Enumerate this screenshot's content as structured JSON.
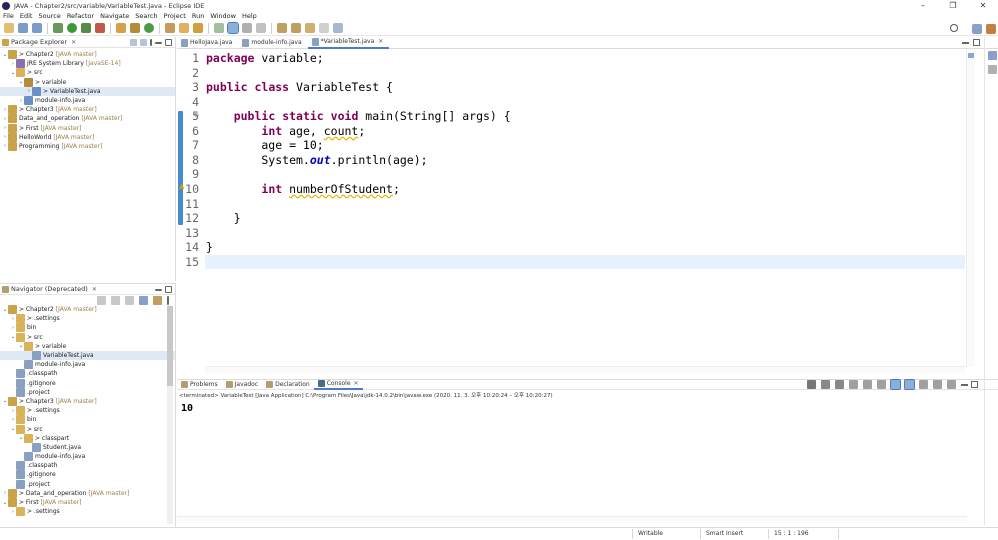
{
  "window": {
    "title": "JAVA - Chapter2/src/variable/VariableTest.java - Eclipse IDE",
    "minimize": "–",
    "maximize": "❐",
    "close": "✕"
  },
  "menu": [
    "File",
    "Edit",
    "Source",
    "Refactor",
    "Navigate",
    "Search",
    "Project",
    "Run",
    "Window",
    "Help"
  ],
  "package_explorer": {
    "title": "Package Explorer",
    "items": [
      {
        "indent": 0,
        "twisty": "v",
        "label": "> Chapter2",
        "deco": "[JAVA master]",
        "icon": "project-icon",
        "color": "#c9a24a"
      },
      {
        "indent": 1,
        "twisty": ">",
        "label": "JRE System Library",
        "deco": "[JavaSE-14]",
        "icon": "library-icon",
        "color": "#8a6fb0"
      },
      {
        "indent": 1,
        "twisty": "v",
        "label": "> src",
        "deco": "",
        "icon": "folder-icon",
        "color": "#d9b25a"
      },
      {
        "indent": 2,
        "twisty": "v",
        "label": "> variable",
        "deco": "",
        "icon": "package-icon",
        "color": "#b58a3a"
      },
      {
        "indent": 3,
        "twisty": ">",
        "label": "> VariableTest.java",
        "deco": "",
        "icon": "java-file-icon",
        "color": "#6a8fc4",
        "selected": true
      },
      {
        "indent": 2,
        "twisty": ">",
        "label": "module-info.java",
        "deco": "",
        "icon": "java-file-icon",
        "color": "#6a8fc4"
      },
      {
        "indent": 0,
        "twisty": ">",
        "label": "> Chapter3",
        "deco": "[JAVA master]",
        "icon": "project-icon",
        "color": "#c9a24a"
      },
      {
        "indent": 0,
        "twisty": ">",
        "label": "Data_and_operation",
        "deco": "[JAVA master]",
        "icon": "project-icon",
        "color": "#c9a24a"
      },
      {
        "indent": 0,
        "twisty": ">",
        "label": "> First",
        "deco": "[JAVA master]",
        "icon": "project-icon",
        "color": "#c9a24a"
      },
      {
        "indent": 0,
        "twisty": ">",
        "label": "HelloWorld",
        "deco": "[JAVA master]",
        "icon": "project-icon",
        "color": "#c9a24a"
      },
      {
        "indent": 0,
        "twisty": ">",
        "label": "Programming",
        "deco": "[JAVA master]",
        "icon": "project-icon",
        "color": "#c9a24a"
      }
    ]
  },
  "navigator": {
    "title": "Navigator (Deprecated)",
    "items": [
      {
        "indent": 0,
        "twisty": "v",
        "label": "> Chapter2",
        "deco": "[JAVA master]",
        "color": "#c9a24a"
      },
      {
        "indent": 1,
        "twisty": ">",
        "label": "> .settings",
        "deco": "",
        "color": "#d9b25a"
      },
      {
        "indent": 1,
        "twisty": ">",
        "label": "bin",
        "deco": "",
        "color": "#d9b25a"
      },
      {
        "indent": 1,
        "twisty": "v",
        "label": "> src",
        "deco": "",
        "color": "#d9b25a"
      },
      {
        "indent": 2,
        "twisty": "v",
        "label": "> variable",
        "deco": "",
        "color": "#d9b25a"
      },
      {
        "indent": 3,
        "twisty": "",
        "label": "VariableTest.java",
        "deco": "",
        "color": "#8aa0c0",
        "selected": true
      },
      {
        "indent": 2,
        "twisty": "",
        "label": "module-info.java",
        "deco": "",
        "color": "#8aa0c0"
      },
      {
        "indent": 1,
        "twisty": "",
        "label": ".classpath",
        "deco": "",
        "color": "#8aa0c0"
      },
      {
        "indent": 1,
        "twisty": "",
        "label": ".gitignore",
        "deco": "",
        "color": "#8aa0c0"
      },
      {
        "indent": 1,
        "twisty": "",
        "label": ".project",
        "deco": "",
        "color": "#8aa0c0"
      },
      {
        "indent": 0,
        "twisty": "v",
        "label": "> Chapter3",
        "deco": "[JAVA master]",
        "color": "#c9a24a"
      },
      {
        "indent": 1,
        "twisty": ">",
        "label": "> .settings",
        "deco": "",
        "color": "#d9b25a"
      },
      {
        "indent": 1,
        "twisty": ">",
        "label": "bin",
        "deco": "",
        "color": "#d9b25a"
      },
      {
        "indent": 1,
        "twisty": "v",
        "label": "> src",
        "deco": "",
        "color": "#d9b25a"
      },
      {
        "indent": 2,
        "twisty": "v",
        "label": "> classpart",
        "deco": "",
        "color": "#d9b25a"
      },
      {
        "indent": 3,
        "twisty": "",
        "label": "Student.java",
        "deco": "",
        "color": "#8aa0c0"
      },
      {
        "indent": 2,
        "twisty": "",
        "label": "module-info.java",
        "deco": "",
        "color": "#8aa0c0"
      },
      {
        "indent": 1,
        "twisty": "",
        "label": ".classpath",
        "deco": "",
        "color": "#8aa0c0"
      },
      {
        "indent": 1,
        "twisty": "",
        "label": ".gitignore",
        "deco": "",
        "color": "#8aa0c0"
      },
      {
        "indent": 1,
        "twisty": "",
        "label": ".project",
        "deco": "",
        "color": "#8aa0c0"
      },
      {
        "indent": 0,
        "twisty": ">",
        "label": "> Data_and_operation",
        "deco": "[JAVA master]",
        "color": "#c9a24a"
      },
      {
        "indent": 0,
        "twisty": "v",
        "label": "> First",
        "deco": "[JAVA master]",
        "color": "#c9a24a"
      },
      {
        "indent": 1,
        "twisty": ">",
        "label": "> .settings",
        "deco": "",
        "color": "#d9b25a"
      }
    ]
  },
  "editor": {
    "tabs": [
      {
        "label": "HelloJava.java",
        "active": false
      },
      {
        "label": "module-info.java",
        "active": false
      },
      {
        "label": "*VariableTest.java",
        "active": true
      }
    ],
    "line_numbers": [
      "1",
      "2",
      "3",
      "4",
      "5",
      "6",
      "7",
      "8",
      "9",
      "10",
      "11",
      "12",
      "13",
      "14",
      "15"
    ],
    "lines": [
      [
        {
          "t": "package",
          "c": "kw"
        },
        {
          "t": " variable;"
        }
      ],
      [],
      [
        {
          "t": "public",
          "c": "kw"
        },
        {
          "t": " "
        },
        {
          "t": "class",
          "c": "kw"
        },
        {
          "t": " VariableTest {"
        }
      ],
      [],
      [
        {
          "t": "    "
        },
        {
          "t": "public",
          "c": "kw"
        },
        {
          "t": " "
        },
        {
          "t": "static",
          "c": "kw"
        },
        {
          "t": " "
        },
        {
          "t": "void",
          "c": "kw"
        },
        {
          "t": " main(String[] args) {"
        }
      ],
      [
        {
          "t": "        "
        },
        {
          "t": "int",
          "c": "kw"
        },
        {
          "t": " age, "
        },
        {
          "t": "count",
          "c": "warn"
        },
        {
          "t": ";"
        }
      ],
      [
        {
          "t": "        age = 10;"
        }
      ],
      [
        {
          "t": "        System."
        },
        {
          "t": "out",
          "c": "static-f"
        },
        {
          "t": ".println(age);"
        }
      ],
      [],
      [
        {
          "t": "        "
        },
        {
          "t": "int",
          "c": "kw"
        },
        {
          "t": " "
        },
        {
          "t": "numberOfStudent",
          "c": "warn"
        },
        {
          "t": ";"
        }
      ],
      [],
      [
        {
          "t": "    }"
        }
      ],
      [],
      [
        {
          "t": "}"
        }
      ],
      []
    ]
  },
  "console": {
    "tabs": [
      {
        "label": "Problems",
        "active": false,
        "icon": "problems-icon"
      },
      {
        "label": "Javadoc",
        "active": false,
        "icon": "javadoc-icon"
      },
      {
        "label": "Declaration",
        "active": false,
        "icon": "declaration-icon"
      },
      {
        "label": "Console",
        "active": true,
        "icon": "console-icon"
      }
    ],
    "status": "<terminated> VariableTest [Java Application] C:\\Program Files\\Java\\jdk-14.0.2\\bin\\javaw.exe  (2020. 11. 3. 오후 10:20:24 – 오후 10:20:27)",
    "output": "10"
  },
  "statusbar": {
    "writable": "Writable",
    "insert_mode": "Smart Insert",
    "position": "15 : 1 : 196"
  }
}
